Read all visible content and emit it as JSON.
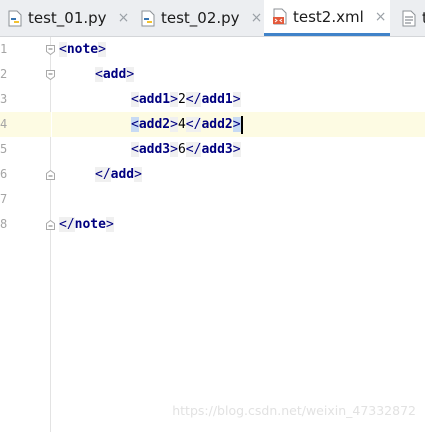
{
  "tabs": [
    {
      "label": "test_01.py",
      "close": "×",
      "icon": "python-file-icon"
    },
    {
      "label": "test_02.py",
      "close": "×",
      "icon": "python-file-icon"
    },
    {
      "label": "test2.xml",
      "close": "×",
      "icon": "xml-file-icon",
      "active": true
    },
    {
      "label": "t",
      "icon": "text-file-icon"
    }
  ],
  "gutter": {
    "line_numbers": [
      "1",
      "2",
      "3",
      "4",
      "5",
      "6",
      "7",
      "8"
    ]
  },
  "editor": {
    "line1": {
      "open": "<",
      "tag": "note",
      "close": ">"
    },
    "line2": {
      "open": "<",
      "tag": "add",
      "close": ">"
    },
    "line3": {
      "open": "<",
      "tag": "add1",
      "close": ">",
      "value": "2",
      "end_open": "</",
      "end_tag": "add1",
      "end_close": ">"
    },
    "line4": {
      "open": "<",
      "tag": "add2",
      "close": ">",
      "value": "4",
      "end_open": "</",
      "end_tag": "add2",
      "end_close": ">"
    },
    "line5": {
      "open": "<",
      "tag": "add3",
      "close": ">",
      "value": "6",
      "end_open": "</",
      "end_tag": "add3",
      "end_close": ">"
    },
    "line6": {
      "open": "</",
      "tag": "add",
      "close": ">"
    },
    "line8": {
      "open": "</",
      "tag": "note",
      "close": ">"
    }
  },
  "watermark": "https://blog.csdn.net/weixin_47332872",
  "colors": {
    "tab_active_underline": "#4083c9",
    "tag_color": "#000080",
    "current_line": "#fdfbe3",
    "match_highlight": "#c7daf4"
  }
}
